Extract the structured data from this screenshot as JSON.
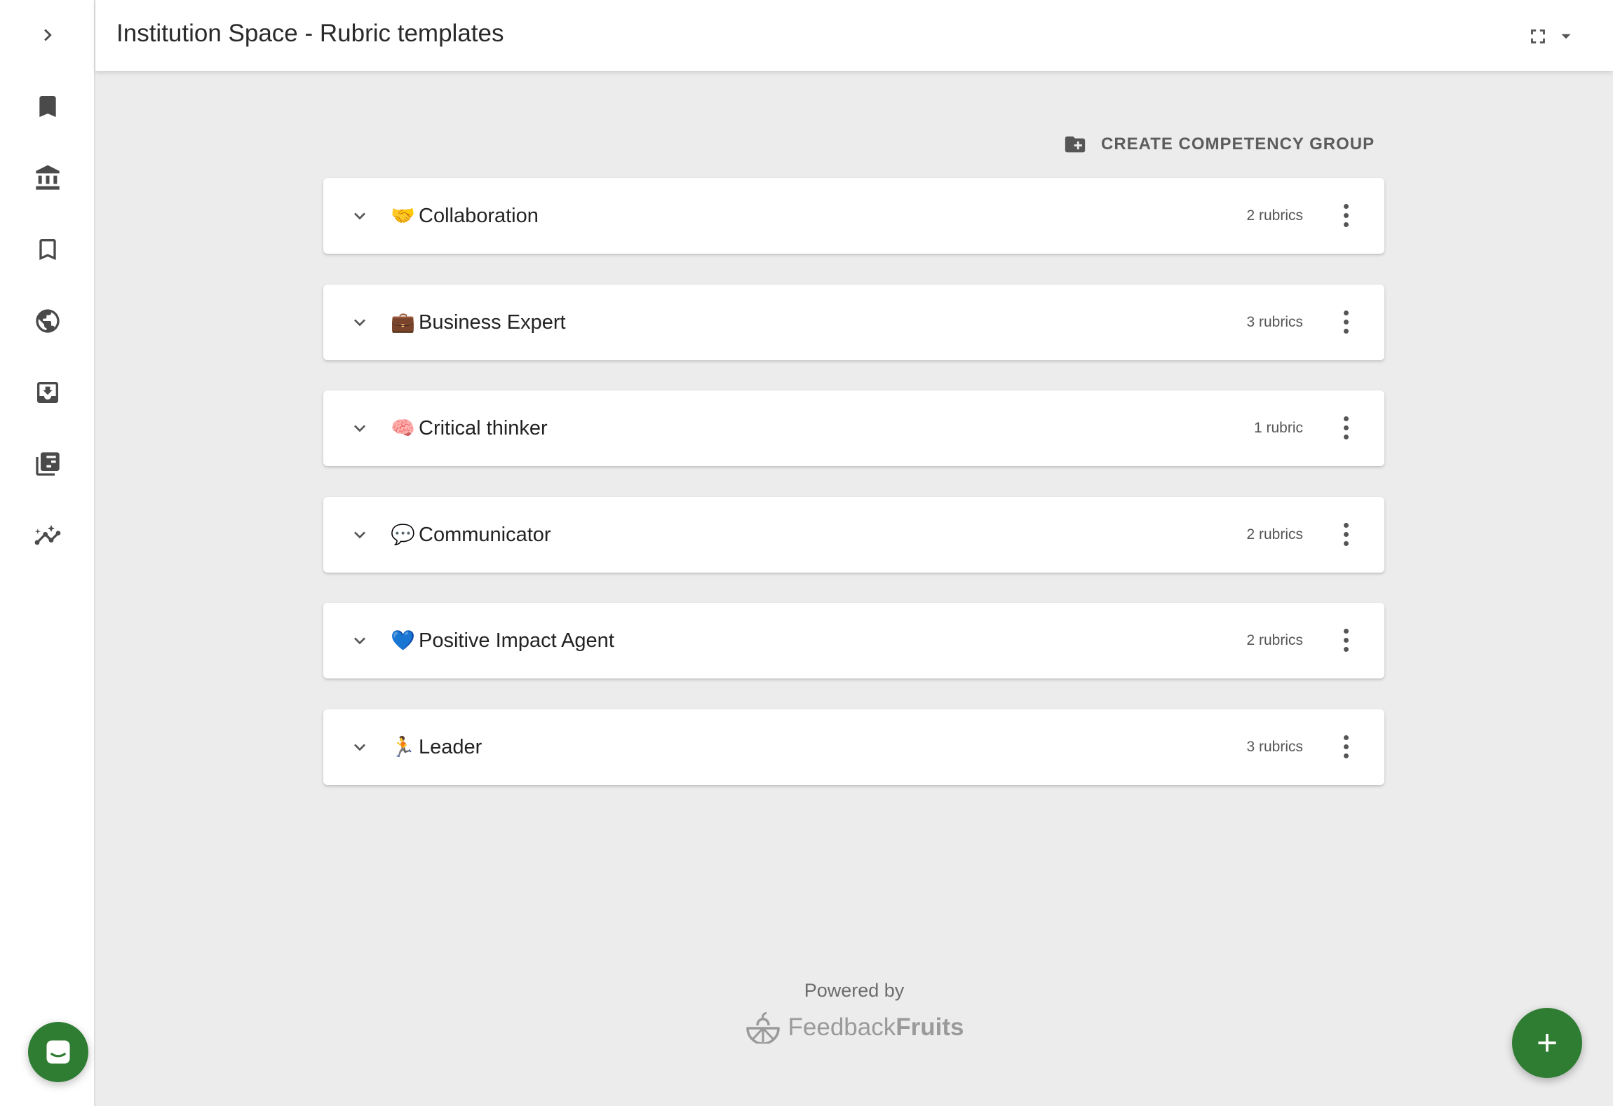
{
  "header": {
    "title": "Institution Space - Rubric templates"
  },
  "rail": {
    "items": [
      {
        "icon": "chevron-right-icon"
      },
      {
        "icon": "bookmark-filled-icon"
      },
      {
        "icon": "institution-icon"
      },
      {
        "icon": "bookmark-outline-icon"
      },
      {
        "icon": "globe-icon"
      },
      {
        "icon": "inbox-download-icon"
      },
      {
        "icon": "library-books-icon"
      },
      {
        "icon": "analytics-icon"
      }
    ]
  },
  "main": {
    "create_group_label": "CREATE COMPETENCY GROUP",
    "groups": [
      {
        "emoji": "🤝",
        "name": "Collaboration",
        "count": "2 rubrics"
      },
      {
        "emoji": "💼",
        "name": "Business Expert",
        "count": "3 rubrics"
      },
      {
        "emoji": "🧠",
        "name": "Critical thinker",
        "count": "1 rubric"
      },
      {
        "emoji": "💬",
        "name": "Communicator",
        "count": "2 rubrics"
      },
      {
        "emoji": "💙",
        "name": "Positive Impact Agent",
        "count": "2 rubrics"
      },
      {
        "emoji": "🏃",
        "name": "Leader",
        "count": "3 rubrics"
      }
    ]
  },
  "footer": {
    "powered_by": "Powered by",
    "brand_light": "Feedback",
    "brand_bold": "Fruits"
  },
  "fab": {
    "add_label": "+"
  },
  "colors": {
    "accent": "#2e7d32",
    "background": "#ececec"
  }
}
